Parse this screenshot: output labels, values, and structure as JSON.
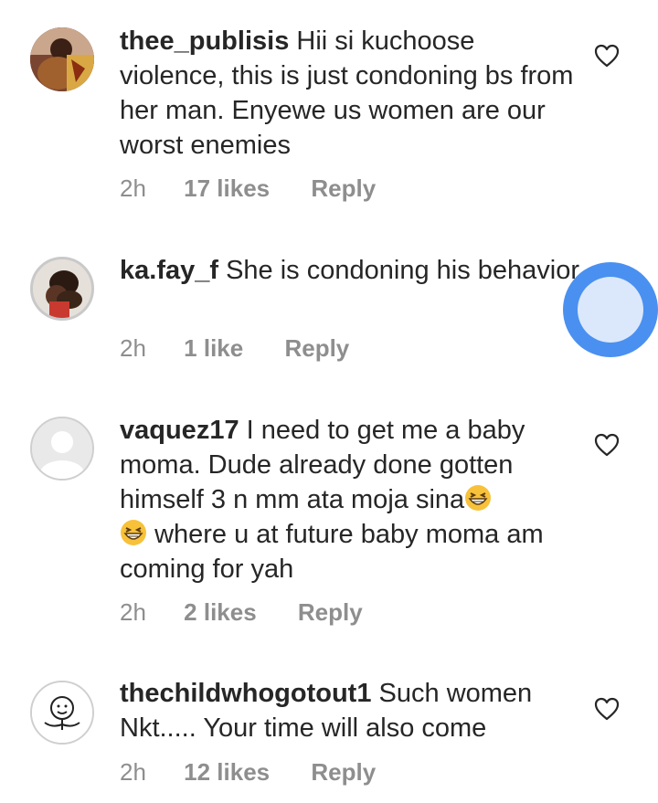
{
  "comments": [
    {
      "username": "thee_publisis",
      "text": "Hii si kuchoose violence, this is just condoning bs from her man. Enyewe us women are our worst enemies",
      "time": "2h",
      "likes": "17 likes",
      "reply": "Reply",
      "avatar": "photo"
    },
    {
      "username": "ka.fay_f",
      "text": "She is condoning his behavior.",
      "time": "2h",
      "likes": "1 like",
      "reply": "Reply",
      "avatar": "photo"
    },
    {
      "username": "vaquez17",
      "text_part1": "I need to get me a baby moma. Dude already done gotten himself 3 n mm ata moja sina",
      "text_part2": "where u at future baby moma am coming for yah",
      "time": "2h",
      "likes": "2 likes",
      "reply": "Reply",
      "avatar": "default-silhouette"
    },
    {
      "username": "thechildwhogotout1",
      "text": "Such women Nkt..... Your time will also come",
      "time": "2h",
      "likes": "12 likes",
      "reply": "Reply",
      "avatar": "doodle-face"
    }
  ],
  "icons": {
    "like": "heart-outline-icon",
    "emoji": "grinning-squinting-face-emoji"
  },
  "colors": {
    "text": "#262626",
    "secondary": "#8e8e8e",
    "touch_indicator": "#4a90f0"
  }
}
